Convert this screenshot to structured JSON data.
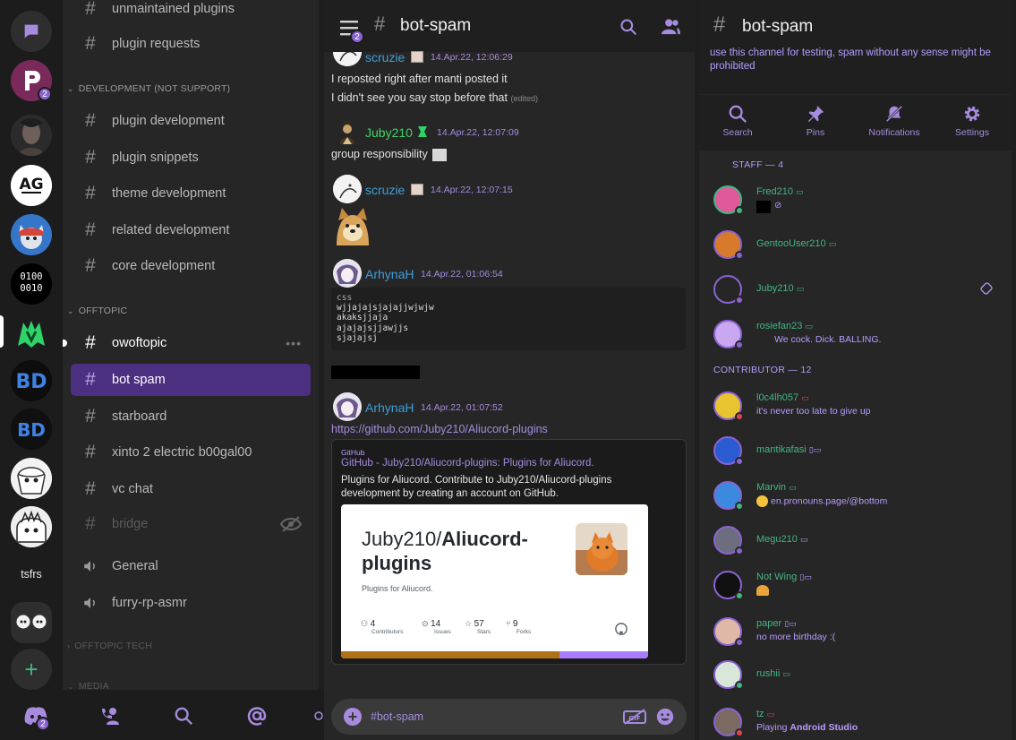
{
  "servers": {
    "top_icon": "chat-bubble-icon",
    "items": [
      {
        "name": "P server",
        "badge": "2"
      },
      {
        "name": "dark portrait server"
      },
      {
        "name": "AG server",
        "badge": ""
      },
      {
        "name": "cat mascot server"
      },
      {
        "name": "binary server",
        "text_top": "0100",
        "text_bottom": "0010"
      },
      {
        "name": "Aliucord server"
      },
      {
        "name": "BD server"
      },
      {
        "name": "BD dark server"
      },
      {
        "name": "anime server 1"
      },
      {
        "name": "anime server 2"
      },
      {
        "name": "tsfrs"
      },
      {
        "name": "folder"
      }
    ],
    "folder_label": "tsfrs",
    "add_label": "+",
    "home_badge": "2"
  },
  "channels": {
    "items_top": [
      {
        "label": "unmaintained plugins"
      },
      {
        "label": "plugin requests"
      }
    ],
    "cat_dev": "DEVELOPMENT (NOT SUPPORT)",
    "dev_items": [
      {
        "label": "plugin development"
      },
      {
        "label": "plugin snippets"
      },
      {
        "label": "theme development"
      },
      {
        "label": "related development"
      },
      {
        "label": "core development"
      }
    ],
    "cat_offtopic": "OFFTOPIC",
    "offtopic_items": [
      {
        "label": "owoftopic"
      },
      {
        "label": "bot spam"
      },
      {
        "label": "starboard"
      },
      {
        "label": "xinto 2 electric b00gal00"
      },
      {
        "label": "vc chat"
      },
      {
        "label": "bridge"
      },
      {
        "label": "General"
      },
      {
        "label": "furry-rp-asmr"
      }
    ],
    "cat_offtopic_tech": "OFFTOPIC TECH",
    "cat_media": "MEDIA"
  },
  "chat": {
    "title": "bot-spam",
    "menu_badge": "2",
    "messages": {
      "m1_author": "scruzie",
      "m1_time": "14.Apr.22, 12:06:29",
      "m1_line1": "I reposted right after manti posted it",
      "m1_line2": "I didn't see you say stop before that",
      "m1_edited": "(edited)",
      "m2_author": "Juby210",
      "m2_time": "14.Apr.22, 12:07:09",
      "m2_text": "group responsibility",
      "m3_author": "scruzie",
      "m3_time": "14.Apr.22, 12:07:15",
      "m4_author": "ArhynaH",
      "m4_time": "14.Apr.22, 01:06:54",
      "code_lang": "css",
      "code_lines": [
        "wjjajajsjajajjwjwjw",
        "akaksjjaja",
        "ajajajsjjawjjs",
        "sjajajsj"
      ],
      "m5_author": "ArhynaH",
      "m5_time": "14.Apr.22, 01:07:52",
      "m5_link": "https://github.com/Juby210/Aliucord-plugins"
    },
    "embed": {
      "provider": "GitHub",
      "title": "GitHub - Juby210/Aliucord-plugins: Plugins for Aliucord.",
      "description": "Plugins for Aliucord. Contribute to Juby210/Aliucord-plugins development by creating an account on GitHub.",
      "card_owner": "Juby210/",
      "card_repo": "Aliucord-",
      "card_repo2": "plugins",
      "card_desc": "Plugins for Aliucord.",
      "stats": [
        {
          "num": "4",
          "label": "Contributors"
        },
        {
          "num": "14",
          "label": "Issues"
        },
        {
          "num": "57",
          "label": "Stars"
        },
        {
          "num": "9",
          "label": "Forks"
        }
      ]
    },
    "input_placeholder": "#bot-spam"
  },
  "panel": {
    "title": "bot-spam",
    "topic": "use this channel for testing, spam without any sense might be prohibited",
    "actions": [
      "Search",
      "Pins",
      "Notifications",
      "Settings"
    ],
    "staff_header": "STAFF — 4",
    "contributor_header": "CONTRIBUTOR — 12",
    "staff": [
      {
        "name": "Fred210",
        "status": "",
        "name_color": "#43b581",
        "dot": "#43b581"
      },
      {
        "name": "GentooUser210",
        "status": "",
        "name_color": "#43b581",
        "dot": "#8a63d2"
      },
      {
        "name": "Juby210",
        "status": "",
        "name_color": "#43b581",
        "dot": "#8a63d2"
      },
      {
        "name": "rosiefan23",
        "status": "We cock. Dick. BALLING.",
        "name_color": "#43b581",
        "dot": "#8a63d2"
      }
    ],
    "contributors": [
      {
        "name": "l0c4lh057",
        "status": "it's never too late to give up",
        "name_color": "#43b581",
        "dot": "#e0434b"
      },
      {
        "name": "mantikafasi",
        "status": "",
        "name_color": "#43b581",
        "dot": "#8a63d2"
      },
      {
        "name": "Marvin",
        "status": "en.pronouns.page/@bottom",
        "name_color": "#43b581",
        "dot": "#43b581"
      },
      {
        "name": "Megu210",
        "status": "",
        "name_color": "#43b581",
        "dot": "#8a63d2"
      },
      {
        "name": "Not Wing",
        "status": "",
        "name_color": "#43b581",
        "dot": "#43b581"
      },
      {
        "name": "paper",
        "status": "no more birthday :(",
        "name_color": "#43b581",
        "dot": "#8a63d2"
      },
      {
        "name": "rushii",
        "status": "",
        "name_color": "#43b581",
        "dot": "#43b581"
      },
      {
        "name": "tz",
        "status_prefix": "Playing ",
        "status_bold": "Android Studio",
        "name_color": "#43b581",
        "dot": "#e0434b"
      }
    ]
  },
  "colors": {
    "accent": "#8a63d2",
    "link": "#3d9ed9",
    "online": "#43b581",
    "dnd": "#e0434b",
    "active_channel": "#4b2f80"
  }
}
